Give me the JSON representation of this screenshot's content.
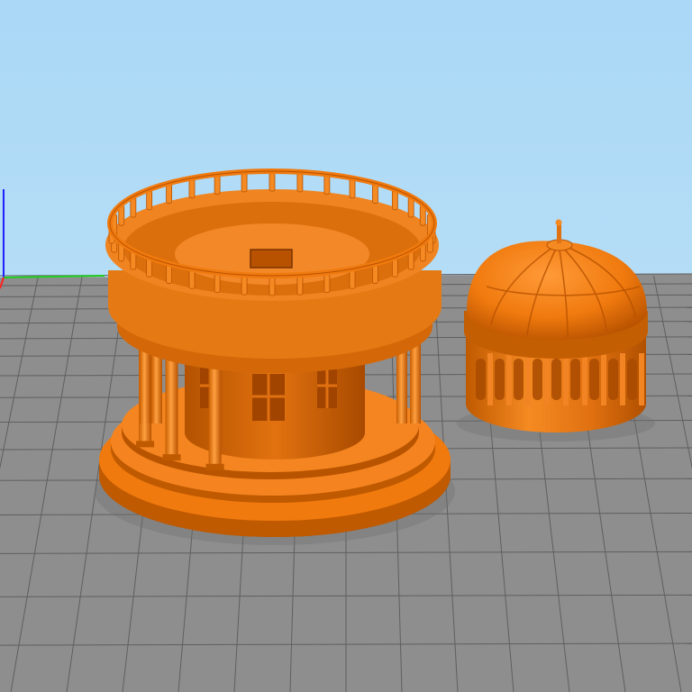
{
  "viewport": {
    "sky_color_top": "#aad8f6",
    "sky_color_bottom": "#c4e4f8",
    "bed_color": "#8e8e8e",
    "grid_line_color": "#5f5f5f",
    "model_color": "#f07a0e",
    "model_shadow_color": "#a84a00",
    "model_highlight_color": "#ffa040",
    "axis_x_color": "#ff2020",
    "axis_y_color": "#20d020",
    "axis_z_color": "#2020ff"
  },
  "models": [
    {
      "name": "temple-base-with-colonnade"
    },
    {
      "name": "temple-dome-roof"
    }
  ]
}
